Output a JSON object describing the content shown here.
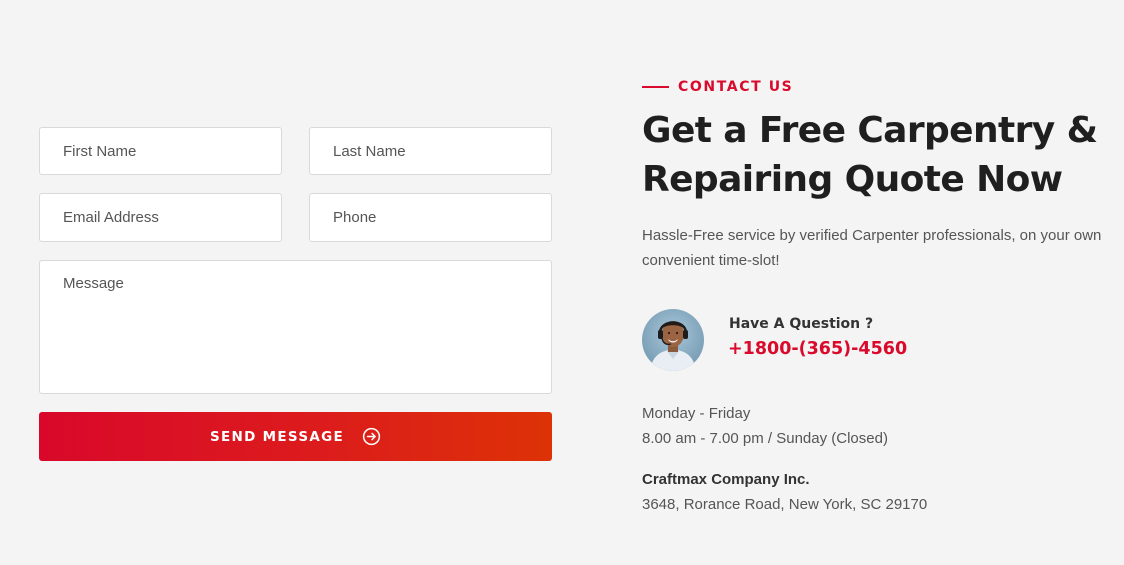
{
  "form": {
    "first_name_placeholder": "First Name",
    "last_name_placeholder": "Last Name",
    "email_placeholder": "Email Address",
    "phone_placeholder": "Phone",
    "message_placeholder": "Message",
    "submit_label": "SEND MESSAGE",
    "submit_icon": "arrow-right-circle-icon"
  },
  "info": {
    "eyebrow": "CONTACT US",
    "headline": "Get a Free Carpentry & Repairing Quote Now",
    "description": "Hassle-Free service by verified Carpenter professionals, on your own convenient time-slot!",
    "question_label": "Have A Question ?",
    "phone": "+1800-(365)-4560",
    "hours_days": "Monday - Friday",
    "hours_times": "8.00 am - 7.00 pm / Sunday (Closed)",
    "company": "Craftmax Company Inc.",
    "address": "3648, Rorance Road, New York, SC 29170"
  },
  "colors": {
    "accent": "#d90a2b",
    "button_gradient_start": "#d9082a",
    "button_gradient_end": "#dd3206",
    "background": "#f4f4f4"
  }
}
